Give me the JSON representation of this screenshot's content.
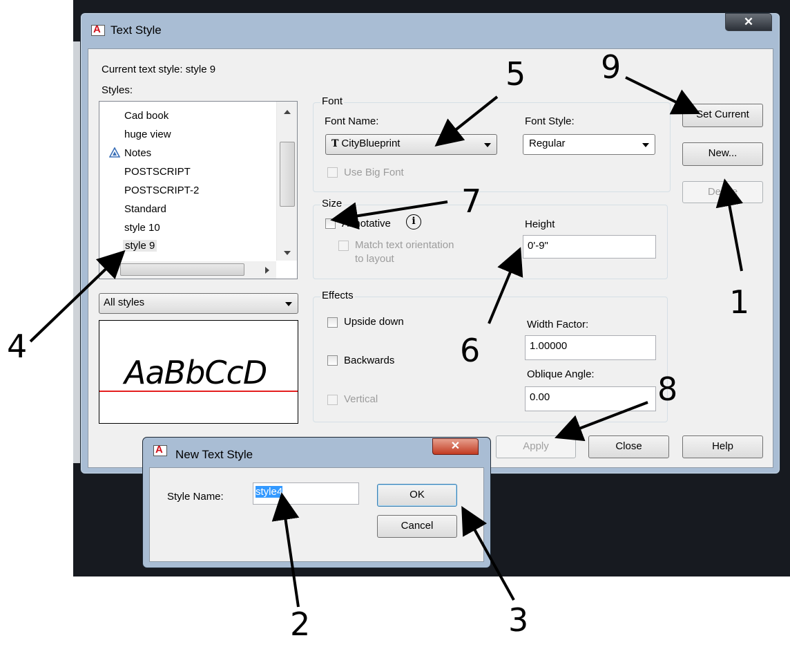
{
  "main_dialog": {
    "title": "Text Style",
    "close_glyph": "✕",
    "current_text_style_label": "Current text style:",
    "current_text_style_value": "style 9",
    "styles_label": "Styles:",
    "styles": [
      "Cad book",
      "huge view",
      "Notes",
      "POSTSCRIPT",
      "POSTSCRIPT-2",
      "Standard",
      "style 10",
      "style 9"
    ],
    "selected_style": "style 9",
    "filter_value": "All styles",
    "preview_text": "AaBbCcD",
    "font_group": "Font",
    "font_name_label": "Font Name:",
    "font_name_value": "CityBlueprint",
    "font_style_label": "Font Style:",
    "font_style_value": "Regular",
    "use_big_font": "Use Big Font",
    "size_group": "Size",
    "annotative": "Annotative",
    "match_orientation_1": "Match text orientation",
    "match_orientation_2": "to layout",
    "height_label": "Height",
    "height_value": "0'-9\"",
    "effects_group": "Effects",
    "upside_down": "Upside down",
    "backwards": "Backwards",
    "vertical": "Vertical",
    "width_factor_label": "Width Factor:",
    "width_factor_value": "1.00000",
    "oblique_label": "Oblique Angle:",
    "oblique_value": "0.00",
    "buttons": {
      "set_current": "Set Current",
      "new": "New...",
      "delete": "Delete",
      "apply": "Apply",
      "close": "Close",
      "help": "Help"
    }
  },
  "new_dialog": {
    "title": "New Text Style",
    "style_name_label": "Style Name:",
    "style_name_value": "style4",
    "ok": "OK",
    "cancel": "Cancel"
  },
  "annotations": [
    "1",
    "2",
    "3",
    "4",
    "5",
    "6",
    "7",
    "8",
    "9"
  ],
  "colors": {
    "title_bar": "#a9bdd4",
    "cad_background": "#171a20",
    "baseline": "#e41e1e",
    "selection": "#3399ff"
  }
}
